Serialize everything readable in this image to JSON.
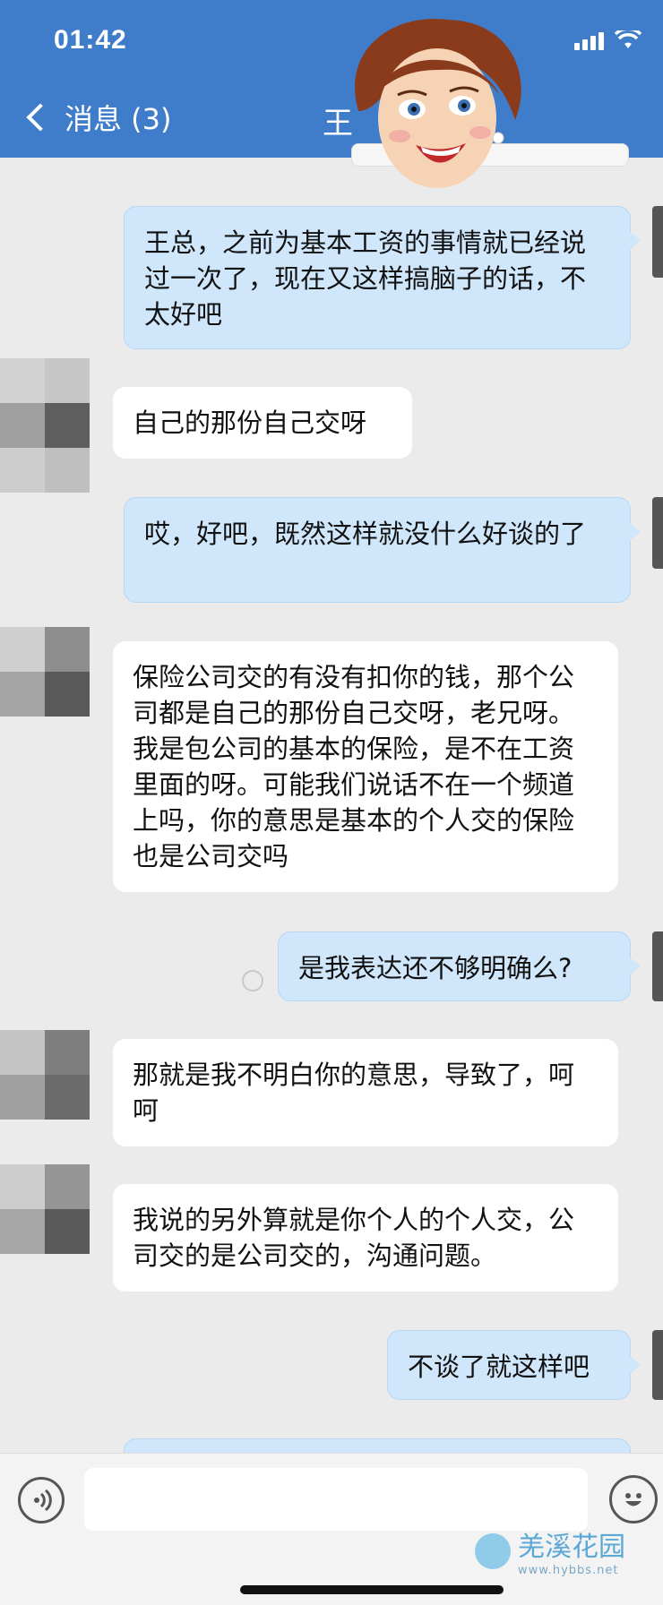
{
  "status": {
    "time": "01:42"
  },
  "header": {
    "back_label": "消息 (3)",
    "title": "王"
  },
  "messages": [
    {
      "side": "out",
      "text": "王总，之前为基本工资的事情就已经说过一次了，现在又这样搞脑子的话，不太好吧"
    },
    {
      "side": "in",
      "text": "自己的那份自己交呀"
    },
    {
      "side": "out",
      "text": "哎，好吧，既然这样就没什么好谈的了"
    },
    {
      "side": "in",
      "text": "保险公司交的有没有扣你的钱，那个公司都是自己的那份自己交呀，老兄呀。我是包公司的基本的保险，是不在工资里面的呀。可能我们说话不在一个频道上吗，你的意思是基本的个人交的保险也是公司交吗"
    },
    {
      "side": "out",
      "text": "是我表达还不够明确么?"
    },
    {
      "side": "in",
      "text": "那就是我不明白你的意思，导致了，呵呵"
    },
    {
      "side": "in",
      "text": "我说的另外算就是你个人的个人交，公司交的是公司交的，沟通问题。"
    },
    {
      "side": "out",
      "text": "不谈了就这样吧"
    }
  ],
  "input": {
    "placeholder": ""
  },
  "watermark": {
    "name": "羌溪花园",
    "url": "www.hybbs.net"
  }
}
